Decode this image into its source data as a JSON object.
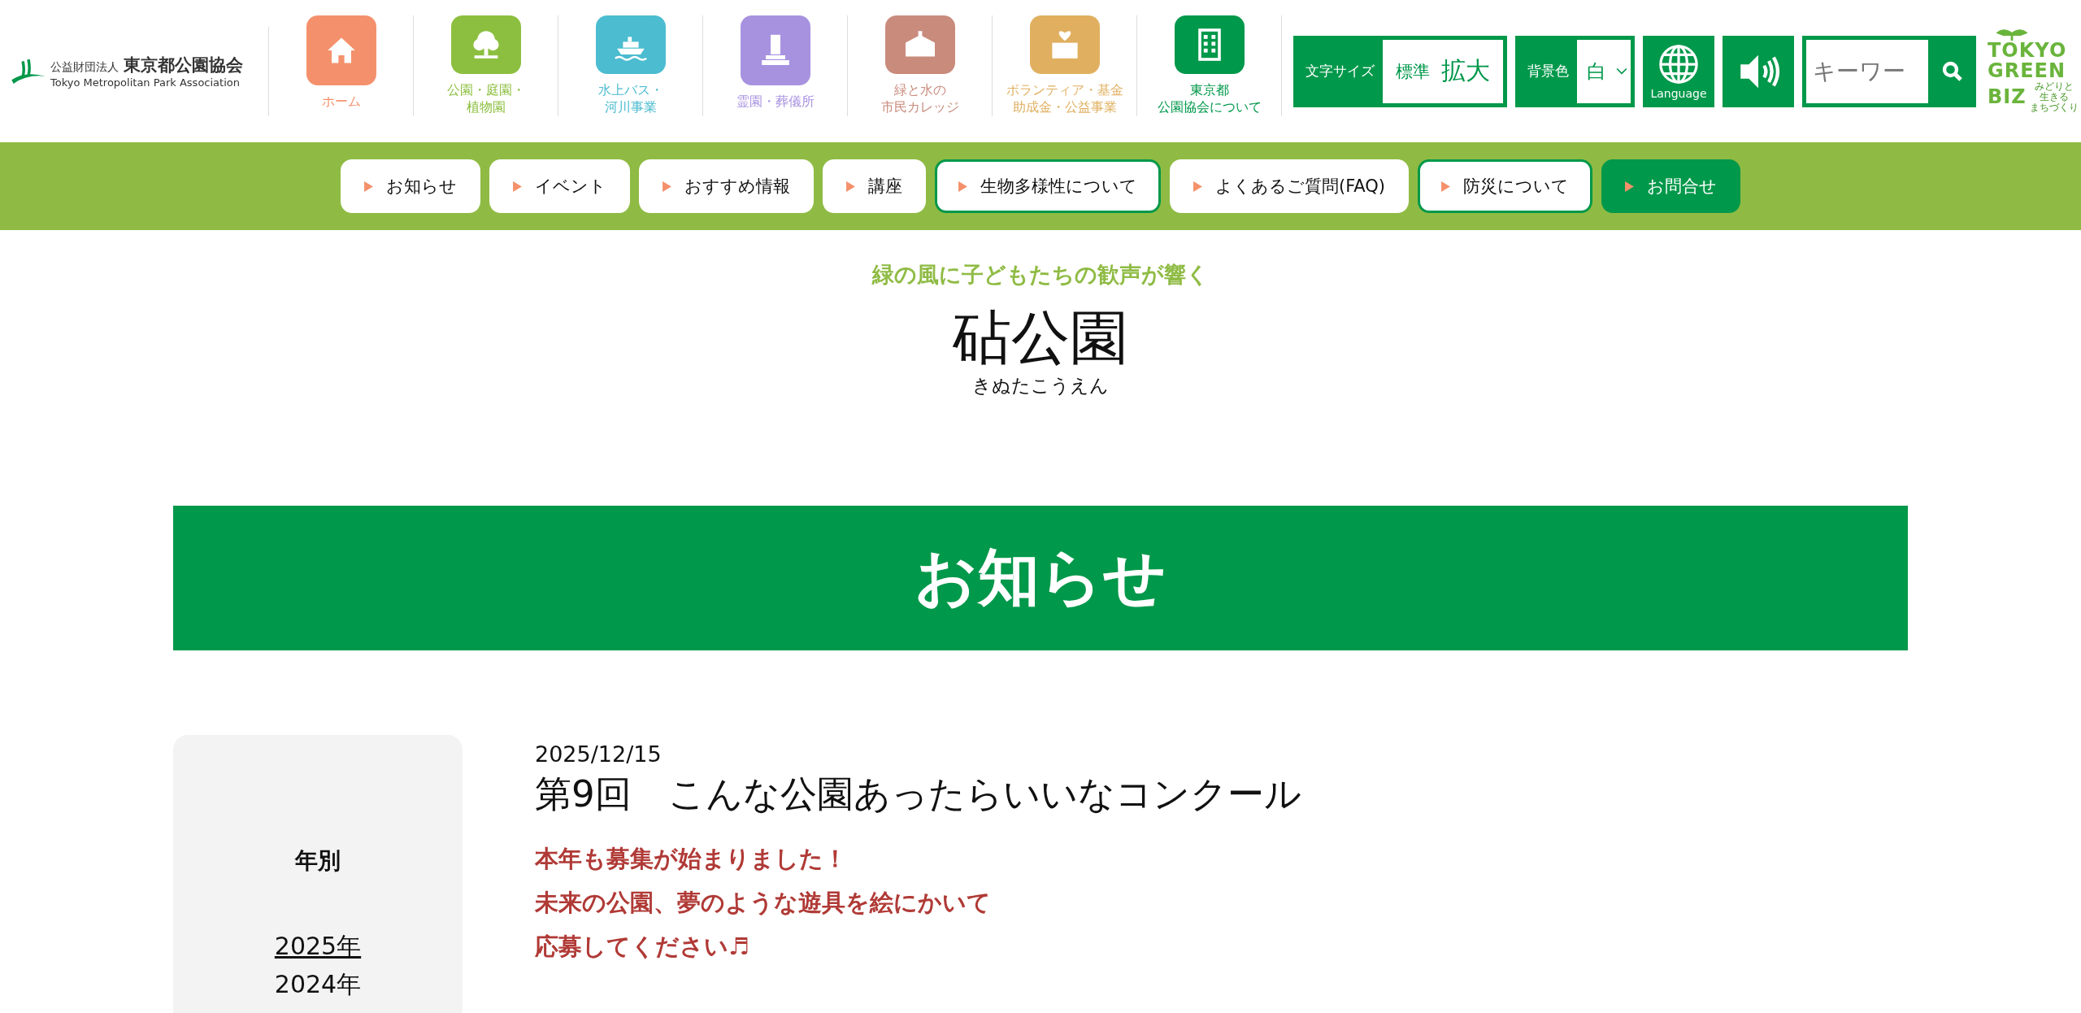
{
  "header": {
    "logo": {
      "org_type": "公益財団法人",
      "org_name": "東京都公園協会",
      "org_name_en": "Tokyo Metropolitan Park Association"
    },
    "nav": [
      {
        "lines": [
          "ホーム"
        ],
        "color": "#f4916c"
      },
      {
        "lines": [
          "公園・庭園・",
          "植物園"
        ],
        "color": "#8cbf3f"
      },
      {
        "lines": [
          "水上バス・",
          "河川事業"
        ],
        "color": "#4cbcd0"
      },
      {
        "lines": [
          "霊園・葬儀所"
        ],
        "color": "#a792e0"
      },
      {
        "lines": [
          "緑と水の",
          "市民カレッジ"
        ],
        "color": "#c98b7c"
      },
      {
        "lines": [
          "ボランティア・基金",
          "助成金・公益事業"
        ],
        "color": "#e0b060"
      },
      {
        "lines": [
          "東京都",
          "公園協会について"
        ],
        "color": "#00984a"
      }
    ],
    "font_size": {
      "label": "文字サイズ",
      "options": [
        "標準",
        "拡大"
      ]
    },
    "background": {
      "label": "背景色",
      "value": "白"
    },
    "language": {
      "label": "Language"
    },
    "search": {
      "placeholder": "キーワー"
    },
    "green_biz": {
      "lines": [
        "TOKYO",
        "GREEN",
        "BIZ"
      ],
      "tagline": [
        "みどりと",
        "生きる",
        "まちづくり"
      ]
    }
  },
  "menu": [
    {
      "label": "お知らせ",
      "kind": "plain"
    },
    {
      "label": "イベント",
      "kind": "plain"
    },
    {
      "label": "おすすめ情報",
      "kind": "plain"
    },
    {
      "label": "講座",
      "kind": "plain"
    },
    {
      "label": "生物多様性について",
      "kind": "outlined"
    },
    {
      "label": "よくあるご質問(FAQ)",
      "kind": "plain"
    },
    {
      "label": "防災について",
      "kind": "outlined"
    },
    {
      "label": "お問合せ",
      "kind": "filled"
    }
  ],
  "park": {
    "catchphrase": "緑の風に子どもたちの歓声が響く",
    "name": "砧公園",
    "reading": "きぬたこうえん"
  },
  "banner": {
    "title": "お知らせ"
  },
  "sidebar": {
    "heading": "年別",
    "years": [
      {
        "label": "2025年",
        "selected": true
      },
      {
        "label": "2024年",
        "selected": false
      }
    ]
  },
  "article": {
    "date": "2025/12/15",
    "title": "第9回　こんな公園あったらいいなコンクール",
    "lines": [
      "本年も募集が始まりました！",
      "未来の公園、夢のような遊具を絵にかいて",
      "応募してください♬"
    ]
  }
}
